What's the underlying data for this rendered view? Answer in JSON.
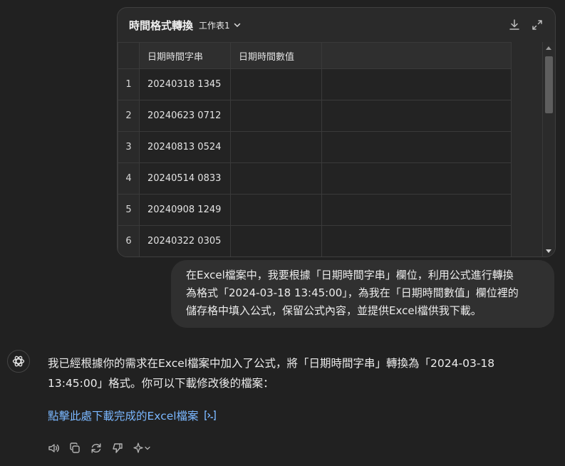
{
  "sheet": {
    "title": "時間格式轉換",
    "tab_label": "工作表1",
    "columns": [
      "日期時間字串",
      "日期時間數值"
    ],
    "rows": [
      {
        "num": "1",
        "value": "20240318 1345"
      },
      {
        "num": "2",
        "value": "20240623 0712"
      },
      {
        "num": "3",
        "value": "20240813 0524"
      },
      {
        "num": "4",
        "value": "20240514 0833"
      },
      {
        "num": "5",
        "value": "20240908 1249"
      },
      {
        "num": "6",
        "value": "20240322 0305"
      }
    ]
  },
  "user_message": {
    "line1": "在Excel檔案中，我要根據「日期時間字串」欄位，利用公式進行轉換",
    "line2": "為格式「2024-03-18 13:45:00」，為我在「日期時間數值」欄位裡的",
    "line3": "儲存格中填入公式，保留公式內容，並提供Excel檔供我下載。"
  },
  "assistant_message": {
    "line1": "我已經根據你的需求在Excel檔案中加入了公式，將「日期時間字串」轉換為「2024-03-18",
    "line2": "13:45:00」格式。你可以下載修改後的檔案：",
    "link_text": "點擊此處下載完成的Excel檔案"
  },
  "icons": {
    "download": "download-icon",
    "expand": "expand-icon",
    "avatar": "openai-logo-icon",
    "read_aloud": "speaker-icon",
    "copy": "copy-icon",
    "regenerate": "refresh-icon",
    "dislike": "thumbs-down-icon",
    "sparkle": "sparkle-icon"
  },
  "colors": {
    "background": "#212121",
    "link": "#7ab7ff",
    "bubble": "#303030"
  }
}
